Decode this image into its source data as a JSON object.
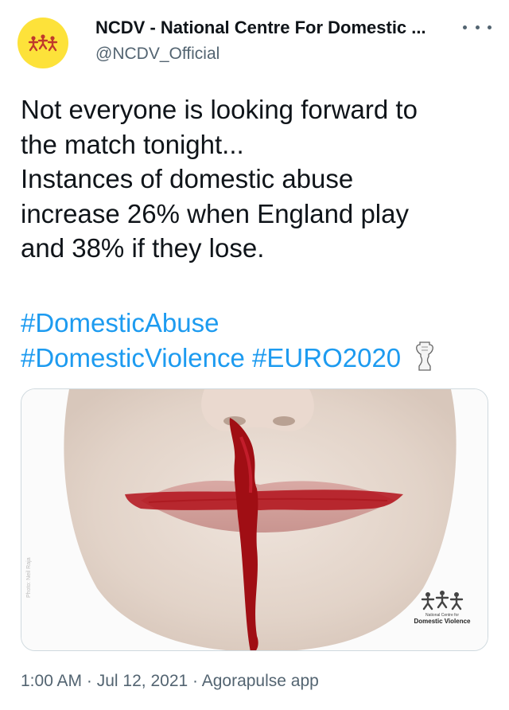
{
  "account": {
    "display_name": "NCDV - National Centre For Domestic ...",
    "handle": "@NCDV_Official",
    "avatar_icon": "ncdv-logo-icon",
    "avatar_color": "#fde23a"
  },
  "tweet": {
    "text_lines": [
      "Not everyone is looking forward to",
      "the match tonight...",
      "Instances of domestic abuse",
      "increase 26% when England play",
      "and 38% if they lose."
    ],
    "hashtags": [
      "#DomesticAbuse",
      "#DomesticViolence",
      "#EURO2020"
    ],
    "hashtag_color": "#1d9bf0",
    "emoji_icon": "trophy-icon"
  },
  "media": {
    "logo_small_text": "National Centre for",
    "logo_text": "Domestic Violence",
    "photo_credit": "Photo: Neil Raja"
  },
  "footer": {
    "time": "1:00 AM",
    "date": "Jul 12, 2021",
    "source": "Agorapulse app",
    "separator": "·"
  }
}
